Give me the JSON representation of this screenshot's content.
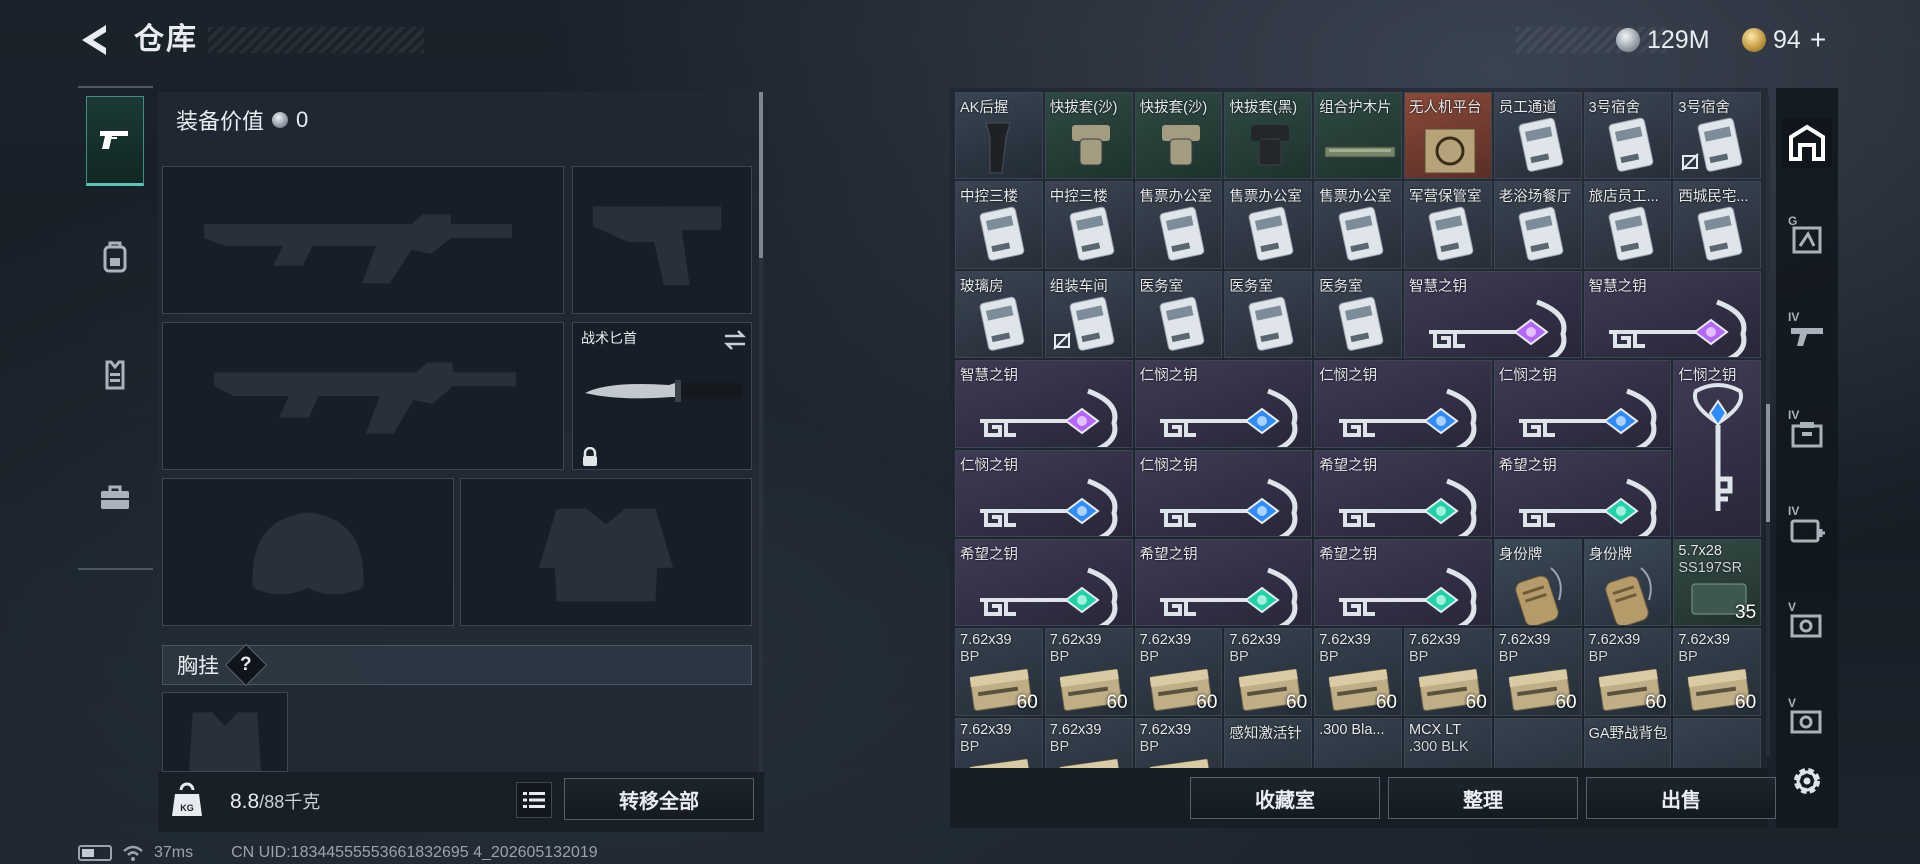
{
  "header": {
    "title": "仓库",
    "back_icon": "back-arrow-icon"
  },
  "currency": {
    "silver": "129M",
    "gold": "94",
    "plus": "+"
  },
  "left_tabs": [
    {
      "icon": "gun-icon",
      "active": true
    },
    {
      "icon": "backpack-icon",
      "active": false
    },
    {
      "icon": "vest-icon",
      "active": false
    },
    {
      "icon": "toolbox-icon",
      "active": false
    }
  ],
  "loadout": {
    "value_label": "装备价值",
    "value": "0",
    "knife_label": "战术匕首",
    "chest_label": "胸挂",
    "chest_help": "?"
  },
  "weight": {
    "current": "8.8",
    "capacity": "/88千克"
  },
  "buttons": {
    "transfer_all": "转移全部",
    "collection": "收藏室",
    "sort": "整理",
    "sell": "出售"
  },
  "status": {
    "latency": "37ms",
    "uid": "CN UID:18344555553661832695 4_202605132019"
  },
  "stash": {
    "rows": [
      [
        {
          "label": "AK后握",
          "type": "grip"
        },
        {
          "label": "快拔套(沙)",
          "type": "holster"
        },
        {
          "label": "快拔套(沙)",
          "type": "holster"
        },
        {
          "label": "快拔套(黑)",
          "type": "holster-black"
        },
        {
          "label": "组合护木片",
          "type": "rail"
        },
        {
          "label": "无人机平台",
          "type": "drone"
        },
        {
          "label": "员工通道",
          "type": "card"
        },
        {
          "label": "3号宿舍",
          "type": "card"
        },
        {
          "label": "3号宿舍",
          "type": "card",
          "mark": true
        }
      ],
      [
        {
          "label": "中控三楼",
          "type": "card"
        },
        {
          "label": "中控三楼",
          "type": "card"
        },
        {
          "label": "售票办公室",
          "type": "card"
        },
        {
          "label": "售票办公室",
          "type": "card"
        },
        {
          "label": "售票办公室",
          "type": "card"
        },
        {
          "label": "军营保管室",
          "type": "card"
        },
        {
          "label": "老浴场餐厅",
          "type": "card"
        },
        {
          "label": "旅店员工...",
          "type": "card"
        },
        {
          "label": "西城民宅...",
          "type": "card"
        }
      ],
      [
        {
          "label": "玻璃房",
          "type": "card"
        },
        {
          "label": "组装车间",
          "type": "card",
          "mark": true
        },
        {
          "label": "医务室",
          "type": "card"
        },
        {
          "label": "医务室",
          "type": "card"
        },
        {
          "label": "医务室",
          "type": "card"
        },
        {
          "label": "智慧之钥",
          "type": "key",
          "gem": "#b566ff",
          "span": 2
        },
        {
          "label": "智慧之钥",
          "type": "key",
          "gem": "#b566ff",
          "span": 2
        }
      ],
      [
        {
          "label": "智慧之钥",
          "type": "key",
          "gem": "#b566ff",
          "span": 2
        },
        {
          "label": "仁悯之钥",
          "type": "key",
          "gem": "#2f8cff",
          "span": 2
        },
        {
          "label": "仁悯之钥",
          "type": "key",
          "gem": "#2f8cff",
          "span": 2
        },
        {
          "label": "仁悯之钥",
          "type": "key",
          "gem": "#2f8cff",
          "span": 2
        },
        {
          "label": "仁悯之钥",
          "type": "keyv",
          "gem": "#2f8cff",
          "tall": true
        }
      ],
      [
        {
          "label": "仁悯之钥",
          "type": "key",
          "gem": "#2f8cff",
          "span": 2
        },
        {
          "label": "仁悯之钥",
          "type": "key",
          "gem": "#2f8cff",
          "span": 2
        },
        {
          "label": "希望之钥",
          "type": "key",
          "gem": "#1ed3a8",
          "span": 2
        },
        {
          "label": "希望之钥",
          "type": "key",
          "gem": "#1ed3a8",
          "span": 2
        }
      ],
      [
        {
          "label": "希望之钥",
          "type": "key",
          "gem": "#1ed3a8",
          "span": 2
        },
        {
          "label": "希望之钥",
          "type": "key",
          "gem": "#1ed3a8",
          "span": 2
        },
        {
          "label": "希望之钥",
          "type": "key",
          "gem": "#1ed3a8",
          "span": 2
        },
        {
          "label": "身份牌",
          "type": "tag"
        },
        {
          "label": "身份牌",
          "type": "tag"
        },
        {
          "label": "5.7x28",
          "sub": "SS197SR",
          "type": "ammo57",
          "qty": "35"
        }
      ],
      [
        {
          "label": "7.62x39",
          "sub": "BP",
          "type": "ammo",
          "qty": "60"
        },
        {
          "label": "7.62x39",
          "sub": "BP",
          "type": "ammo",
          "qty": "60"
        },
        {
          "label": "7.62x39",
          "sub": "BP",
          "type": "ammo",
          "qty": "60"
        },
        {
          "label": "7.62x39",
          "sub": "BP",
          "type": "ammo",
          "qty": "60"
        },
        {
          "label": "7.62x39",
          "sub": "BP",
          "type": "ammo",
          "qty": "60"
        },
        {
          "label": "7.62x39",
          "sub": "BP",
          "type": "ammo",
          "qty": "60"
        },
        {
          "label": "7.62x39",
          "sub": "BP",
          "type": "ammo",
          "qty": "60"
        },
        {
          "label": "7.62x39",
          "sub": "BP",
          "type": "ammo",
          "qty": "60"
        },
        {
          "label": "7.62x39",
          "sub": "BP",
          "type": "ammo",
          "qty": "60"
        }
      ],
      [
        {
          "label": "7.62x39",
          "sub": "BP",
          "type": "ammo"
        },
        {
          "label": "7.62x39",
          "sub": "BP",
          "type": "ammo"
        },
        {
          "label": "7.62x39",
          "sub": "BP",
          "type": "ammo"
        },
        {
          "label": "感知激活针",
          "type": "blank"
        },
        {
          "label": ".300 Bla...",
          "type": "blank"
        },
        {
          "label": "MCX LT",
          "sub": ".300 BLK",
          "type": "blank"
        },
        {
          "label": "",
          "type": "blank"
        },
        {
          "label": "GA野战背包",
          "type": "blank"
        },
        {
          "label": "",
          "type": "blank"
        }
      ]
    ]
  },
  "right_rail": [
    {
      "icon": "stash-house-icon",
      "active": true
    },
    {
      "icon": "shelf-icon",
      "level": "G"
    },
    {
      "icon": "weapon-rack-icon",
      "level": "IV"
    },
    {
      "icon": "storage-box-icon",
      "level": "IV"
    },
    {
      "icon": "medical-case-icon",
      "level": "IV"
    },
    {
      "icon": "safe-icon",
      "level": "V"
    },
    {
      "icon": "safe-icon",
      "level": "V"
    },
    {
      "icon": "gear-icon"
    }
  ]
}
